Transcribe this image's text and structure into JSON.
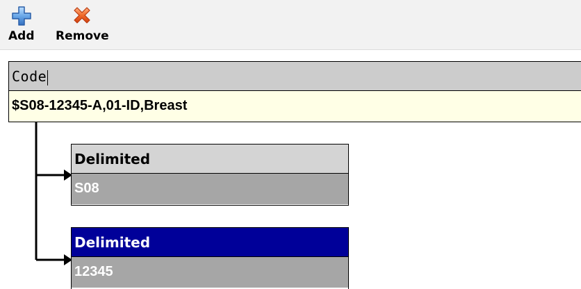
{
  "toolbar": {
    "add_label": "Add",
    "add_icon": "plus-icon",
    "remove_label": "Remove",
    "remove_icon": "x-icon"
  },
  "root": {
    "header": "Code",
    "value": "$S08-12345-A,01-ID,Breast"
  },
  "children": [
    {
      "header": "Delimited",
      "value": "S08",
      "selected": false
    },
    {
      "header": "Delimited",
      "value": "12345",
      "selected": true
    }
  ],
  "colors": {
    "selected_header": "#000099",
    "value_bg": "#a6a6a6",
    "root_value_bg": "#ffffe6",
    "header_bg": "#cccccc",
    "remove_icon": "#e8501e",
    "add_icon": "#5a96dc"
  }
}
